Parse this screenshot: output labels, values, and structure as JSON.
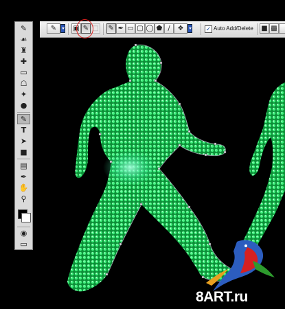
{
  "options_bar": {
    "auto_add_delete": {
      "label": "Auto Add/Delete",
      "checked": true
    }
  },
  "watermark": {
    "text": "8ART.ru"
  },
  "colors": {
    "figure_green": "#1fcf5a",
    "figure_green_dark": "#0a7a2c",
    "glow": "#6ff5b0",
    "background": "#000000",
    "highlight_circle": "#e0201e"
  },
  "icons": {
    "toolbox": [
      "brush",
      "history-brush",
      "clone-stamp",
      "healing-brush",
      "eraser",
      "paint-bucket",
      "blur",
      "dodge",
      "pen",
      "type",
      "path-select",
      "shape",
      "notes",
      "eyedropper",
      "hand",
      "zoom",
      "color-swatches",
      "quick-mask",
      "screen-mode"
    ],
    "options": [
      "pen-preset",
      "shape-layers",
      "paths",
      "fill-pixels",
      "pen",
      "freeform-pen",
      "rectangle",
      "rounded-rectangle",
      "ellipse",
      "polygon",
      "line",
      "custom-shape"
    ]
  }
}
